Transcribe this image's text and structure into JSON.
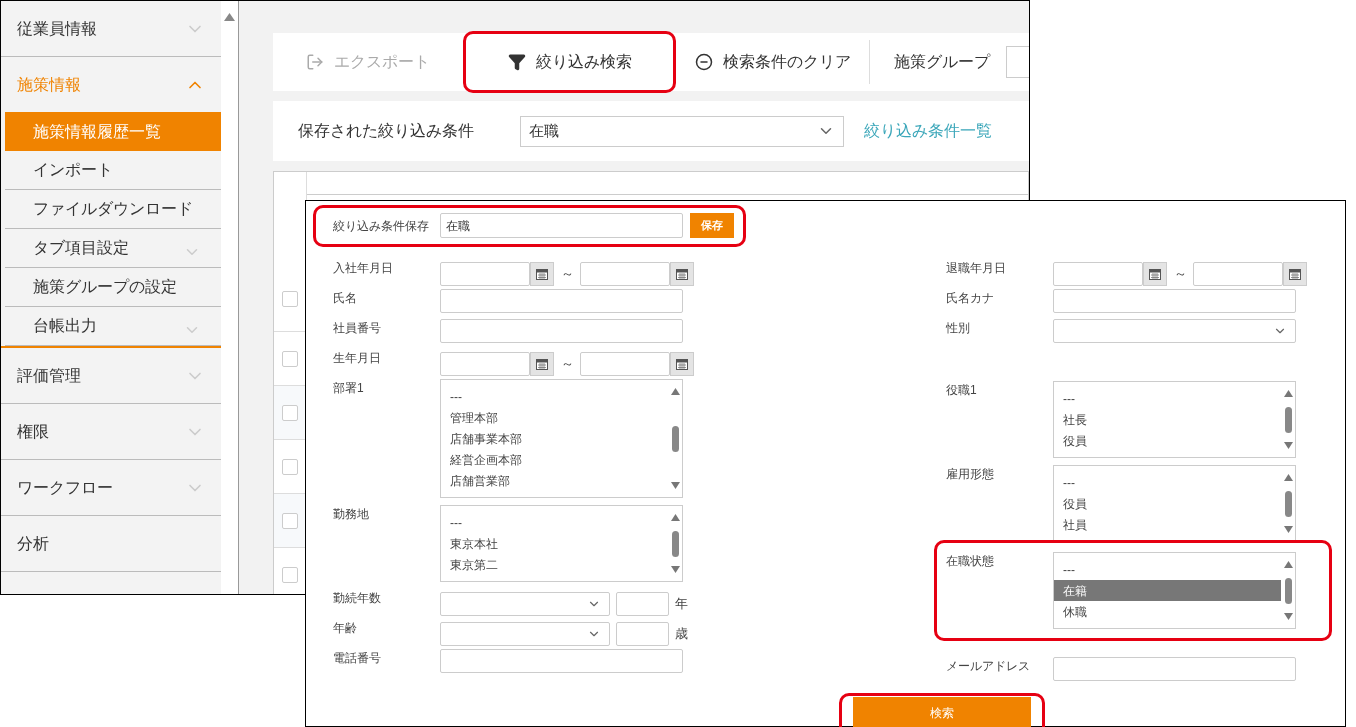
{
  "sidebar": {
    "items": [
      {
        "label": "従業員情報",
        "kind": "group",
        "expanded": false
      },
      {
        "label": "施策情報",
        "kind": "group",
        "expanded": true,
        "children": [
          {
            "label": "施策情報履歴一覧",
            "kind": "link",
            "selected": true
          },
          {
            "label": "インポート",
            "kind": "link",
            "selected": false
          },
          {
            "label": "ファイルダウンロード",
            "kind": "link",
            "selected": false
          },
          {
            "label": "タブ項目設定",
            "kind": "group",
            "selected": false
          },
          {
            "label": "施策グループの設定",
            "kind": "link",
            "selected": false
          },
          {
            "label": "台帳出力",
            "kind": "group",
            "selected": false
          }
        ]
      },
      {
        "label": "評価管理",
        "kind": "group",
        "expanded": false
      },
      {
        "label": "権限",
        "kind": "group",
        "expanded": false
      },
      {
        "label": "ワークフロー",
        "kind": "group",
        "expanded": false
      },
      {
        "label": "分析",
        "kind": "link",
        "expanded": false
      }
    ]
  },
  "toolbar": {
    "buttons": [
      {
        "label": "エクスポート",
        "kind": "export",
        "disabled": true,
        "highlighted": false
      },
      {
        "label": "絞り込み検索",
        "kind": "filter",
        "disabled": false,
        "highlighted": true
      },
      {
        "label": "検索条件のクリア",
        "kind": "clear",
        "disabled": false,
        "highlighted": false
      }
    ],
    "group_label": "施策グループ"
  },
  "saved_filter": {
    "label": "保存された絞り込み条件",
    "value": "在職",
    "link": "絞り込み条件一覧"
  },
  "table": {
    "header_checked": false,
    "rows": [
      {
        "checked": false
      },
      {
        "checked": false
      },
      {
        "checked": false
      },
      {
        "checked": false
      },
      {
        "checked": false
      }
    ]
  },
  "dialog": {
    "save": {
      "label": "絞り込み条件保存",
      "value": "在職",
      "button": "保存",
      "highlighted": true
    },
    "left_fields": [
      {
        "label": "入社年月日",
        "kind": "date_range",
        "separator": "～",
        "highlighted": false
      },
      {
        "label": "氏名",
        "kind": "text",
        "highlighted": false
      },
      {
        "label": "社員番号",
        "kind": "text",
        "highlighted": false
      },
      {
        "label": "生年月日",
        "kind": "date_range",
        "separator": "～",
        "highlighted": false
      },
      {
        "label": "部署1",
        "kind": "listbox",
        "highlighted": false,
        "options": [
          {
            "text": "---",
            "selected": false
          },
          {
            "text": "管理本部",
            "selected": false
          },
          {
            "text": "店舗事業本部",
            "selected": false
          },
          {
            "text": "経営企画本部",
            "selected": false
          },
          {
            "text": "店舗営業部",
            "selected": false
          }
        ]
      },
      {
        "label": "勤務地",
        "kind": "listbox",
        "highlighted": false,
        "options": [
          {
            "text": "---",
            "selected": false
          },
          {
            "text": "東京本社",
            "selected": false
          },
          {
            "text": "東京第二",
            "selected": false
          }
        ]
      },
      {
        "label": "勤続年数",
        "kind": "select_number",
        "unit": "年",
        "highlighted": false
      },
      {
        "label": "年齢",
        "kind": "select_number",
        "unit": "歳",
        "highlighted": false
      },
      {
        "label": "電話番号",
        "kind": "text",
        "highlighted": false
      }
    ],
    "right_fields": [
      {
        "label": "退職年月日",
        "kind": "date_range",
        "separator": "～",
        "highlighted": false
      },
      {
        "label": "氏名カナ",
        "kind": "text",
        "highlighted": false
      },
      {
        "label": "性別",
        "kind": "select",
        "highlighted": false
      },
      {
        "label": "役職1",
        "kind": "listbox",
        "highlighted": false,
        "options": [
          {
            "text": "---",
            "selected": false
          },
          {
            "text": "社長",
            "selected": false
          },
          {
            "text": "役員",
            "selected": false
          }
        ]
      },
      {
        "label": "雇用形態",
        "kind": "listbox",
        "highlighted": false,
        "options": [
          {
            "text": "---",
            "selected": false
          },
          {
            "text": "役員",
            "selected": false
          },
          {
            "text": "社員",
            "selected": false
          }
        ]
      },
      {
        "label": "在職状態",
        "kind": "listbox",
        "highlighted": true,
        "options": [
          {
            "text": "---",
            "selected": false
          },
          {
            "text": "在籍",
            "selected": true
          },
          {
            "text": "休職",
            "selected": false
          }
        ]
      },
      {
        "label": "メールアドレス",
        "kind": "text",
        "highlighted": false
      }
    ],
    "search_button": {
      "label": "検索",
      "highlighted": true
    }
  }
}
